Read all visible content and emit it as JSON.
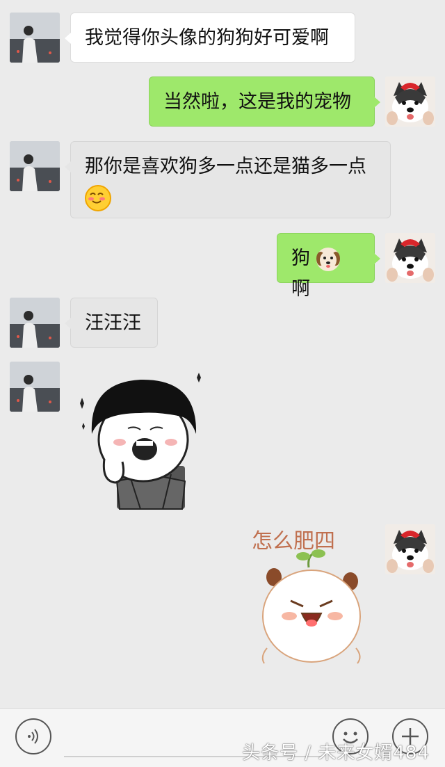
{
  "messages": [
    {
      "side": "left",
      "text": "我觉得你头像的狗狗好可爱啊"
    },
    {
      "side": "right",
      "text": "当然啦，这是我的宠物"
    },
    {
      "side": "left",
      "text_line1": "那你是喜欢狗多一点还是猫多一点",
      "emoji": "blush-smile-emoji"
    },
    {
      "side": "right",
      "text_before": "狗",
      "emoji": "dog-face-emoji",
      "text_after": "啊"
    },
    {
      "side": "left",
      "text": "汪汪汪"
    },
    {
      "side": "left",
      "sticker": "mushroom-head-meme-sticker"
    },
    {
      "side": "right",
      "sticker": "cute-bun-sticker",
      "sticker_text": "怎么肥四"
    }
  ],
  "input_bar": {
    "voice_icon": "voice-icon",
    "emoji_icon": "emoji-icon",
    "plus_icon": "plus-icon"
  },
  "watermark": "头条号 / 未来女婿484",
  "colors": {
    "background": "#ebebeb",
    "outgoing_bubble": "#9ee86b",
    "incoming_bubble": "#ffffff"
  }
}
